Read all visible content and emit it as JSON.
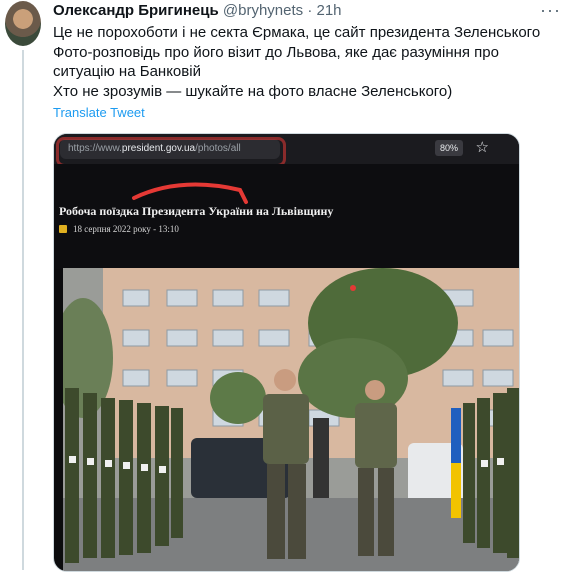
{
  "author": {
    "name": "Олександр Бригинець",
    "handle": "@bryhynets",
    "separator": "·",
    "time": "21h"
  },
  "tweet": {
    "lines": [
      "Це не порохоботи і не секта Єрмака, це сайт президента Зеленського",
      "Фото-розповідь про його візит до Львова, яке дає разуміння про",
      "ситуацію на Банковій",
      "Хто не зрозумів — шукайте на фото власне Зеленського)"
    ],
    "translate_label": "Translate Tweet"
  },
  "screenshot": {
    "url_prefix": "https://www.",
    "url_host": "president.gov.ua",
    "url_path": "/photos/all",
    "zoom": "80%",
    "title": "Робоча поїздка Президента України на Львівщину",
    "date": "18 серпня 2022 року - 13:10"
  },
  "icons": {
    "more": "more-icon",
    "star": "star-icon",
    "calendar": "calendar-icon"
  },
  "colors": {
    "link": "#1d9bf0",
    "annotation": "#e53935",
    "building": "#d8b8a0"
  }
}
